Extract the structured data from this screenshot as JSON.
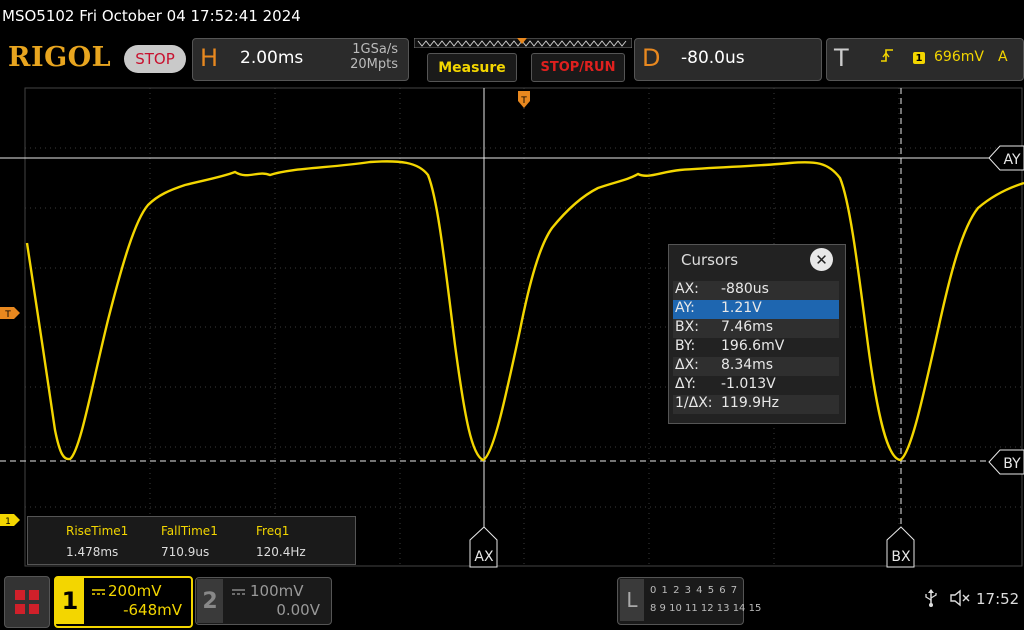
{
  "title_bar": {
    "text": "MSO5102  Fri October 04 17:52:41 2024"
  },
  "brand": {
    "logo": "RIGOL",
    "run_state": "STOP"
  },
  "horizontal": {
    "letter": "H",
    "timebase": "2.00ms",
    "sample_rate": "1GSa/s",
    "memory_depth": "20Mpts"
  },
  "buttons": {
    "measure": "Measure",
    "stop_run": "STOP/RUN"
  },
  "delay": {
    "letter": "D",
    "value": "-80.0us"
  },
  "trigger": {
    "letter": "T",
    "edge_icon": "rising-edge-icon",
    "source": "1",
    "level": "696mV",
    "mode": "A"
  },
  "markers": {
    "trigger_top": "T",
    "trigger_left": "T",
    "ch1_ground": "1",
    "ay": "AY",
    "by": "BY",
    "ax": "AX",
    "bx": "BX"
  },
  "cursors": {
    "title": "Cursors",
    "rows": [
      {
        "key": "AX:",
        "value": "-880us"
      },
      {
        "key": "AY:",
        "value": "1.21V"
      },
      {
        "key": "BX:",
        "value": "7.46ms"
      },
      {
        "key": "BY:",
        "value": "196.6mV"
      },
      {
        "key": "ΔX:",
        "value": "8.34ms"
      },
      {
        "key": "ΔY:",
        "value": "-1.013V"
      },
      {
        "key": "1/ΔX:",
        "value": "119.9Hz"
      }
    ],
    "selected_row": 1
  },
  "measurements": [
    {
      "name": "RiseTime1",
      "value": "1.478ms"
    },
    {
      "name": "FallTime1",
      "value": "710.9us"
    },
    {
      "name": "Freq1",
      "value": "120.4Hz"
    }
  ],
  "channel1": {
    "number": "1",
    "scale": "200mV",
    "offset": "-648mV",
    "color": "#f3d600"
  },
  "channel2": {
    "number": "2",
    "scale": "100mV",
    "offset": "0.00V"
  },
  "logic": {
    "letter": "L",
    "row1": "0 1 2 3  4 5 6 7",
    "row2": "8 9 10 11 12 13 14 15"
  },
  "status": {
    "usb_icon": "usb-icon",
    "sound_icon": "speaker-muted-icon",
    "time": "17:52"
  },
  "colors": {
    "trace": "#f3d600",
    "accent": "#e8881f",
    "stop": "#c8102e",
    "selection": "#1e66b0"
  }
}
